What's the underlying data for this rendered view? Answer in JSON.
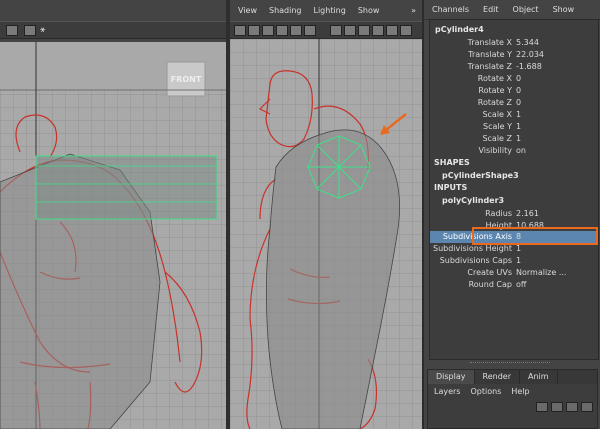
{
  "side_menu": [
    "View",
    "Shading",
    "Lighting",
    "Show"
  ],
  "side_menu_more": "»",
  "front_label": "FRONT",
  "channel_box": {
    "menu": [
      "Channels",
      "Edit",
      "Object",
      "Show"
    ],
    "object_name": "pCylinder4",
    "attributes": [
      {
        "name": "Translate X",
        "value": "5.344"
      },
      {
        "name": "Translate Y",
        "value": "22.034"
      },
      {
        "name": "Translate Z",
        "value": "-1.688"
      },
      {
        "name": "Rotate X",
        "value": "0"
      },
      {
        "name": "Rotate Y",
        "value": "0"
      },
      {
        "name": "Rotate Z",
        "value": "0"
      },
      {
        "name": "Scale X",
        "value": "1"
      },
      {
        "name": "Scale Y",
        "value": "1"
      },
      {
        "name": "Scale Z",
        "value": "1"
      },
      {
        "name": "Visibility",
        "value": "on"
      }
    ],
    "shapes_header": "SHAPES",
    "shape_name": "pCylinderShape3",
    "inputs_header": "INPUTS",
    "input_name": "polyCylinder3",
    "input_attributes": [
      {
        "name": "Radius",
        "value": "2.161"
      },
      {
        "name": "Height",
        "value": "10.688"
      },
      {
        "name": "Subdivisions Axis",
        "value": "8"
      },
      {
        "name": "Subdivisions Height",
        "value": "1"
      },
      {
        "name": "Subdivisions Caps",
        "value": "1"
      },
      {
        "name": "Create UVs",
        "value": "Normalize ..."
      },
      {
        "name": "Round Cap",
        "value": "off"
      }
    ]
  },
  "layer_editor": {
    "tabs": [
      "Display",
      "Render",
      "Anim"
    ],
    "menu": [
      "Layers",
      "Options",
      "Help"
    ]
  },
  "colors": {
    "accent_orange": "#e96a1e",
    "selection_blue": "#5c86b0",
    "wireframe_green": "#3fe08a",
    "sketch_red": "#c8322a"
  }
}
